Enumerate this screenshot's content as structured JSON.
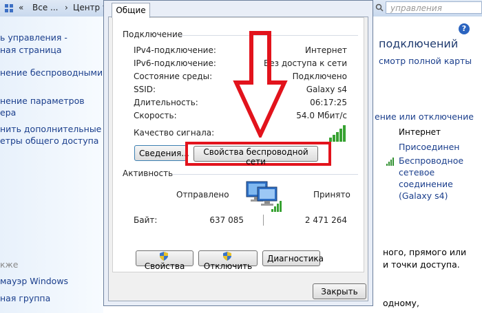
{
  "topbar": {
    "crumbs": [
      "«",
      "Все ...",
      "›",
      "Центр у"
    ],
    "search_placeholder": "управления"
  },
  "left_pane": {
    "links": [
      "ь управления -",
      "ная страница",
      "нение беспроводными",
      "",
      "нение параметров",
      "ера",
      "нить дополнительные",
      "етры общего доступа"
    ],
    "see_also_header": "кже",
    "see_also": [
      "мауэр Windows",
      "ная группа"
    ]
  },
  "right_pane": {
    "title": "подключений",
    "map_link": "смотр полной карты",
    "connect_link": "ение или отключение",
    "internet_label": "Интернет",
    "connected": "Присоединен",
    "wireless_lines": [
      "Беспроводное",
      "сетевое",
      "соединение",
      "(Galaxy s4)"
    ],
    "bottom_lines": [
      "ного, прямого или",
      "и точки доступа.",
      "",
      "одному,"
    ]
  },
  "dialog": {
    "tab_label": "Общие",
    "connection": {
      "group_label": "Подключение",
      "rows": [
        {
          "label": "IPv4-подключение:",
          "value": "Интернет"
        },
        {
          "label": "IPv6-подключение:",
          "value": "Без доступа к сети"
        },
        {
          "label": "Состояние среды:",
          "value": "Подключено"
        },
        {
          "label": "SSID:",
          "value": "Galaxy s4"
        },
        {
          "label": "Длительность:",
          "value": "06:17:25"
        },
        {
          "label": "Скорость:",
          "value": "54.0 Мбит/с"
        }
      ],
      "signal_label": "Качество сигнала:",
      "signal_bars": 5
    },
    "buttons": {
      "details": "Сведения...",
      "wireless_props": "Свойства беспроводной сети",
      "properties": "Свойства",
      "disable": "Отключить",
      "diagnose": "Диагностика",
      "close": "Закрыть"
    },
    "activity": {
      "group_label": "Активность",
      "sent_label": "Отправлено",
      "received_label": "Принято",
      "bytes_label": "Байт:",
      "sent_bytes": "637 085",
      "received_bytes": "2 471 264"
    }
  },
  "annotation": {
    "color": "#e2131c"
  }
}
